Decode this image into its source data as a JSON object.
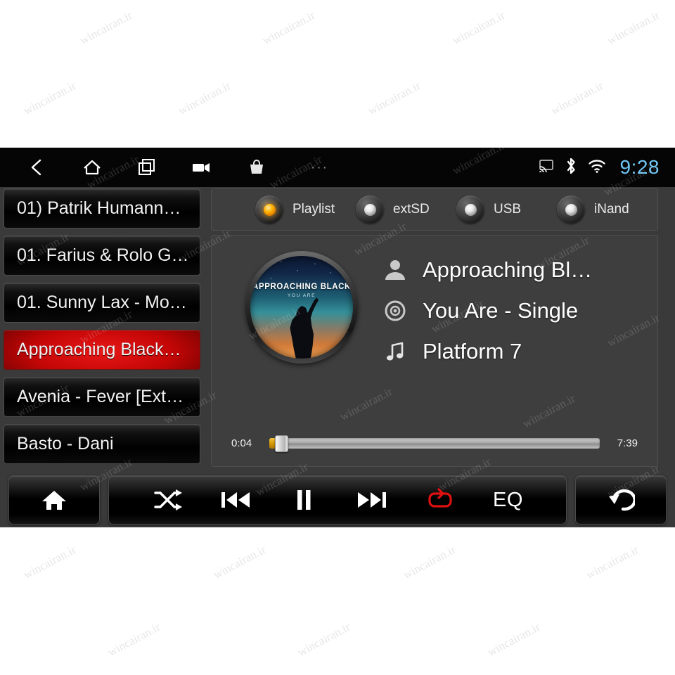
{
  "statusbar": {
    "nav": [
      {
        "name": "back-icon",
        "label": "Back"
      },
      {
        "name": "home-icon",
        "label": "Home"
      },
      {
        "name": "recents-icon",
        "label": "Recent apps"
      },
      {
        "name": "video-camera-icon",
        "label": "Screen record"
      },
      {
        "name": "shopping-bag-icon",
        "label": "Apps"
      }
    ],
    "more_dots": "···",
    "icons": [
      {
        "name": "cast-icon"
      },
      {
        "name": "bluetooth-icon"
      },
      {
        "name": "wifi-icon"
      }
    ],
    "clock": "9:28",
    "clock_color": "#6fc6f5"
  },
  "playlist": {
    "items": [
      {
        "label": "01) Patrik Humann…",
        "selected": false
      },
      {
        "label": "01. Farius & Rolo G…",
        "selected": false
      },
      {
        "label": "01. Sunny Lax - Mo…",
        "selected": false
      },
      {
        "label": "Approaching Black…",
        "selected": true
      },
      {
        "label": "Avenia - Fever [Ext…",
        "selected": false
      },
      {
        "label": "Basto - Dani",
        "selected": false
      }
    ],
    "selected_color": "#c40606"
  },
  "sources": {
    "items": [
      {
        "label": "Playlist",
        "active": true
      },
      {
        "label": "extSD",
        "active": false
      },
      {
        "label": "USB",
        "active": false
      },
      {
        "label": "iNand",
        "active": false
      }
    ],
    "active_led_color": "#ffb300"
  },
  "album_art": {
    "title": "APPROACHING BLACK",
    "subtitle": "YOU ARE"
  },
  "now_playing": {
    "artist": "Approaching Bl…",
    "album": "You Are - Single",
    "track": "Platform 7",
    "artist_icon": "person-icon",
    "album_icon": "disc-icon",
    "track_icon": "music-note-icon"
  },
  "progress": {
    "elapsed": "0:04",
    "total": "7:39",
    "percent": 1
  },
  "controls": {
    "home": {
      "name": "home-icon",
      "label": "Home"
    },
    "shuffle": {
      "name": "shuffle-icon",
      "label": "Shuffle"
    },
    "previous": {
      "name": "previous-track-icon",
      "label": "Previous"
    },
    "pause": {
      "name": "pause-icon",
      "label": "Pause"
    },
    "next": {
      "name": "next-track-icon",
      "label": "Next"
    },
    "repeat": {
      "name": "repeat-icon",
      "label": "Repeat",
      "active": true,
      "color": "#e01010"
    },
    "eq": {
      "name": "eq-button",
      "label": "EQ"
    },
    "back": {
      "name": "back-arrow-icon",
      "label": "Back"
    }
  },
  "watermark": {
    "text": "wincairan.ir"
  }
}
